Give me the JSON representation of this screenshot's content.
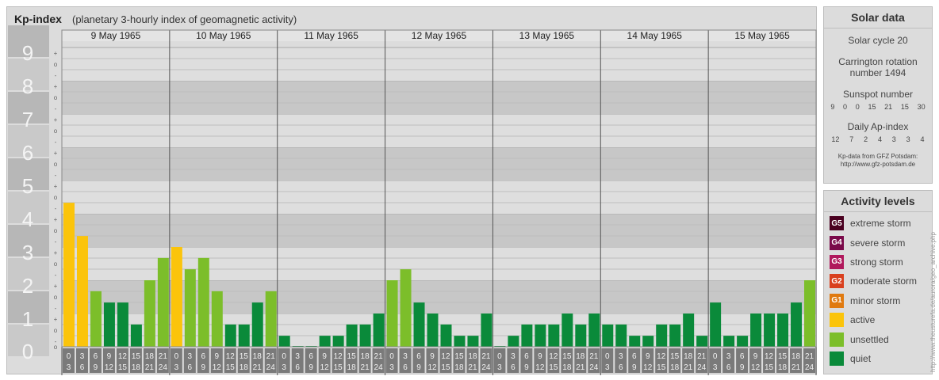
{
  "header": {
    "title": "Kp-index",
    "subtitle": "(planetary 3-hourly index of geomagnetic activity)"
  },
  "colors": {
    "quiet": "#0a8a3a",
    "unsettled": "#7cbe2a",
    "active": "#fbc40b",
    "minor": "#e07a10",
    "moderate": "#d9401e",
    "strong": "#b0185c",
    "severe": "#7a0a4a",
    "extreme": "#4a0020",
    "panel": "#dcdcdc",
    "time_cell": "#7a7a7a"
  },
  "chart_data": {
    "type": "bar",
    "y_levels": [
      "0",
      "1",
      "2",
      "3",
      "4",
      "5",
      "6",
      "7",
      "8",
      "9"
    ],
    "ylim": [
      0,
      9
    ],
    "sublabels": [
      "o",
      "+",
      "-"
    ],
    "days": [
      "9 May 1965",
      "10 May 1965",
      "11 May 1965",
      "12 May 1965",
      "13 May 1965",
      "14 May 1965",
      "15 May 1965"
    ],
    "interval_start": [
      "0",
      "3",
      "6",
      "9",
      "12",
      "15",
      "18",
      "21"
    ],
    "interval_end": [
      "3",
      "6",
      "9",
      "12",
      "15",
      "18",
      "21",
      "24"
    ],
    "values": [
      [
        4.33,
        3.33,
        1.67,
        1.33,
        1.33,
        0.67,
        2.0,
        2.67
      ],
      [
        3.0,
        2.33,
        2.67,
        1.67,
        0.67,
        0.67,
        1.33,
        1.67
      ],
      [
        0.33,
        0.0,
        0.0,
        0.33,
        0.33,
        0.67,
        0.67,
        1.0
      ],
      [
        2.0,
        2.33,
        1.33,
        1.0,
        0.67,
        0.33,
        0.33,
        1.0
      ],
      [
        0.0,
        0.33,
        0.67,
        0.67,
        0.67,
        1.0,
        0.67,
        1.0
      ],
      [
        0.67,
        0.67,
        0.33,
        0.33,
        0.67,
        0.67,
        1.0,
        0.33
      ],
      [
        1.33,
        0.33,
        0.33,
        1.0,
        1.0,
        1.0,
        1.33,
        2.0
      ]
    ],
    "categories_legend": [
      "quiet",
      "unsettled",
      "active"
    ]
  },
  "solar": {
    "heading": "Solar data",
    "cycle": "Solar cycle 20",
    "rotation_line1": "Carrington rotation",
    "rotation_line2": "number 1494",
    "sunspot_heading": "Sunspot number",
    "sunspot_values": [
      "9",
      "0",
      "0",
      "15",
      "21",
      "15",
      "30"
    ],
    "ap_heading": "Daily Ap-index",
    "ap_values": [
      "12",
      "7",
      "2",
      "4",
      "3",
      "3",
      "4"
    ],
    "source_line1": "Kp-data from GFZ Potsdam:",
    "source_line2": "http://www.gfz-potsdam.de"
  },
  "levels": {
    "heading": "Activity levels",
    "items": [
      {
        "badge": "G5",
        "label": "extreme storm",
        "color": "#4a0020"
      },
      {
        "badge": "G4",
        "label": "severe storm",
        "color": "#7a0a4a"
      },
      {
        "badge": "G3",
        "label": "strong storm",
        "color": "#b0185c"
      },
      {
        "badge": "G2",
        "label": "moderate storm",
        "color": "#d9401e"
      },
      {
        "badge": "G1",
        "label": "minor storm",
        "color": "#e07a10"
      },
      {
        "badge": "",
        "label": "active",
        "color": "#fbc40b"
      },
      {
        "badge": "",
        "label": "unsettled",
        "color": "#7cbe2a"
      },
      {
        "badge": "",
        "label": "quiet",
        "color": "#0a8a3a"
      }
    ]
  },
  "watermark": "http://www.theusturefa.de/aurora/geo_archive.php"
}
